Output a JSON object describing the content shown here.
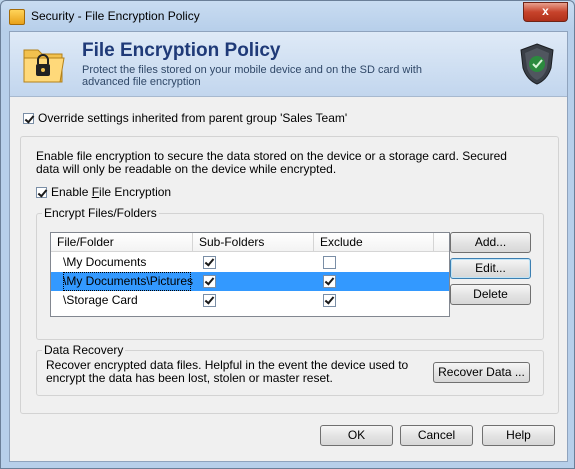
{
  "window": {
    "title": "Security - File Encryption Policy",
    "close_label": "x"
  },
  "banner": {
    "title": "File Encryption Policy",
    "subtitle": "Protect the files stored on your mobile device and on the SD card with advanced file encryption"
  },
  "override": {
    "label": "Override settings inherited from parent group 'Sales Team'",
    "checked": true
  },
  "main": {
    "description": "Enable file encryption to secure the data stored on the device or a storage card. Secured data will only be readable on the device while encrypted.",
    "enable": {
      "label_pre": "Enable ",
      "label_accel": "F",
      "label_post": "ile Encryption",
      "checked": true
    },
    "encrypt_group": {
      "title": "Encrypt Files/Folders",
      "columns": [
        "File/Folder",
        "Sub-Folders",
        "Exclude"
      ],
      "rows": [
        {
          "name": "\\My Documents",
          "sub_folders": true,
          "exclude": false,
          "selected": false
        },
        {
          "name": "\\My Documents\\Pictures",
          "sub_folders": true,
          "exclude": true,
          "selected": true
        },
        {
          "name": "\\Storage Card",
          "sub_folders": true,
          "exclude": true,
          "selected": false
        }
      ],
      "buttons": {
        "add": "Add...",
        "edit": "Edit...",
        "delete": "Delete"
      }
    },
    "recovery": {
      "title": "Data Recovery",
      "text": "Recover encrypted data files. Helpful in the event the device used to encrypt the data has been lost, stolen or master reset.",
      "button": "Recover Data ..."
    }
  },
  "footer": {
    "ok": "OK",
    "cancel": "Cancel",
    "help": "Help"
  },
  "colors": {
    "selection": "#3399ff",
    "banner_title": "#1f3a78",
    "close": "#c7432b"
  }
}
